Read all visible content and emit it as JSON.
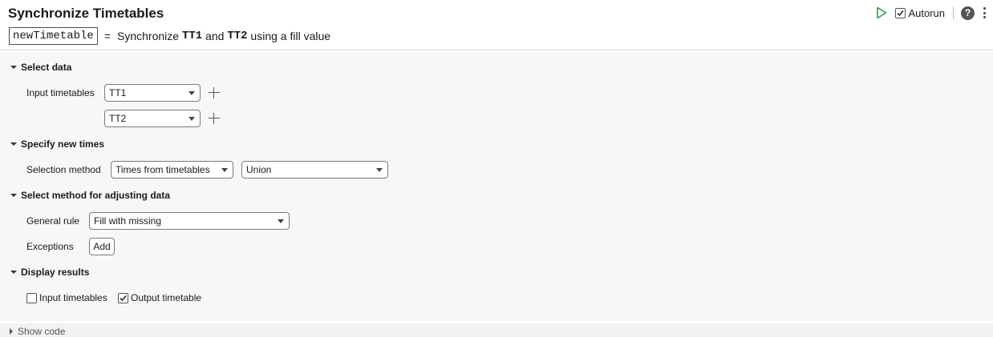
{
  "header": {
    "title": "Synchronize Timetables",
    "summary": {
      "output_var": "newTimetable",
      "equals": "=",
      "text_1": "Synchronize",
      "var_1": "TT1",
      "text_2": "and",
      "var_2": "TT2",
      "text_3": "using a fill value"
    },
    "toolbar": {
      "run_icon": "play-icon",
      "autorun_label": "Autorun",
      "autorun_checked": true,
      "help_icon": "help-icon",
      "help_glyph": "?",
      "more_icon": "kebab-menu-icon"
    }
  },
  "sections": {
    "select_data": {
      "title": "Select data",
      "input_label": "Input timetables",
      "inputs": [
        "TT1",
        "TT2"
      ]
    },
    "new_times": {
      "title": "Specify new times",
      "selection_label": "Selection method",
      "selection_value": "Times from timetables",
      "selection_option_value": "Union"
    },
    "adjust": {
      "title": "Select method for adjusting data",
      "rule_label": "General rule",
      "rule_value": "Fill with missing",
      "exceptions_label": "Exceptions",
      "add_button": "Add"
    },
    "display": {
      "title": "Display results",
      "input_check_label": "Input timetables",
      "input_checked": false,
      "output_check_label": "Output timetable",
      "output_checked": true
    }
  },
  "footer": {
    "show_code_label": "Show code"
  },
  "colors": {
    "run_green": "#2e9e44",
    "panel_bg": "#f7f7f7",
    "help_bg": "#555555"
  }
}
